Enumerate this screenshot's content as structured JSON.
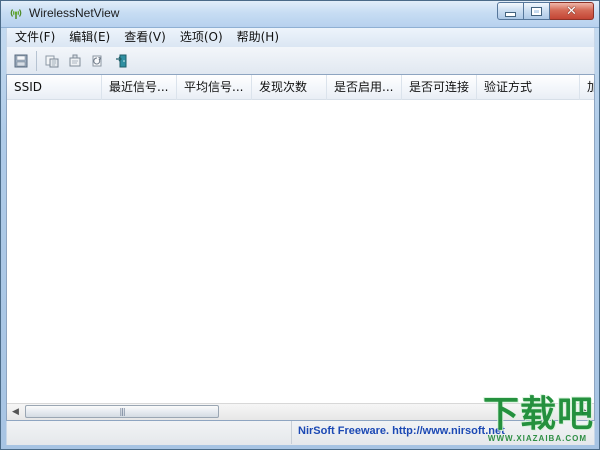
{
  "window": {
    "title": "WirelessNetView",
    "app_icon": "wireless-signal-icon",
    "title_bar_color": "#c9def2",
    "close_button_color": "#c34535"
  },
  "menu": {
    "items": [
      {
        "label": "文件(F)"
      },
      {
        "label": "编辑(E)"
      },
      {
        "label": "查看(V)"
      },
      {
        "label": "选项(O)"
      },
      {
        "label": "帮助(H)"
      }
    ]
  },
  "toolbar": {
    "items": [
      {
        "icon": "save-icon"
      },
      {
        "icon": "copy-icon"
      },
      {
        "icon": "properties-icon"
      },
      {
        "icon": "refresh-icon"
      },
      {
        "icon": "exit-icon"
      }
    ]
  },
  "table": {
    "columns": [
      {
        "label": "SSID"
      },
      {
        "label": "最近信号..."
      },
      {
        "label": "平均信号..."
      },
      {
        "label": "发现次数"
      },
      {
        "label": "是否启用..."
      },
      {
        "label": "是否可连接"
      },
      {
        "label": "验证方式"
      },
      {
        "label": "加"
      }
    ],
    "rows": []
  },
  "scrollbar": {
    "grip": "|||"
  },
  "status": {
    "text": "NirSoft Freeware.  http://www.nirsoft.net"
  },
  "watermark": {
    "main": "下载吧",
    "sub": "WWW.XIAZAIBA.COM",
    "color": "#1a8c35"
  }
}
